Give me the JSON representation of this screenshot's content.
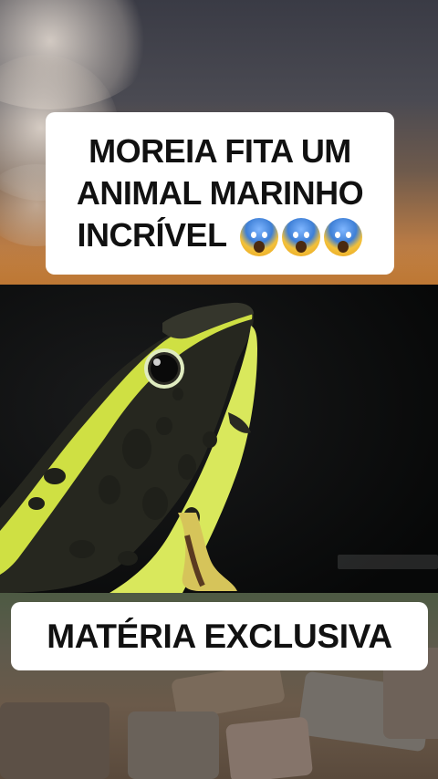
{
  "headline": {
    "line1": "MOREIA FITA UM",
    "line2": "ANIMAL MARINHO",
    "line3": "INCRÍVEL",
    "emojis": [
      "face-screaming-in-fear",
      "face-screaming-in-fear",
      "face-screaming-in-fear"
    ]
  },
  "photo": {
    "subject": "frog-image"
  },
  "banner": {
    "text": "MATÉRIA EXCLUSIVA"
  },
  "colors": {
    "frog_yellow": "#d8e84a",
    "frog_dark": "#2a2a22",
    "card_bg": "#ffffff",
    "text": "#111111"
  }
}
